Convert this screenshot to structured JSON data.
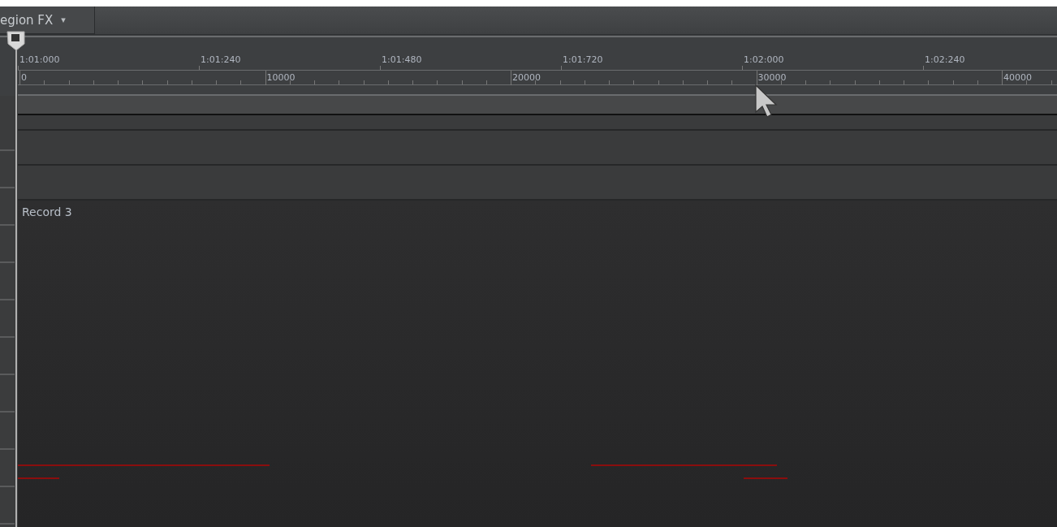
{
  "toolbar": {
    "region_fx_button": {
      "label": "egion FX",
      "caret": "▾"
    }
  },
  "ruler": {
    "time_labels": [
      "1:01:000",
      "1:01:240",
      "1:01:480",
      "1:01:720",
      "1:02:000",
      "1:02:240"
    ],
    "sample_labels": [
      "0",
      "10000",
      "20000",
      "30000",
      "40000"
    ]
  },
  "clip": {
    "name": "Record 3"
  }
}
